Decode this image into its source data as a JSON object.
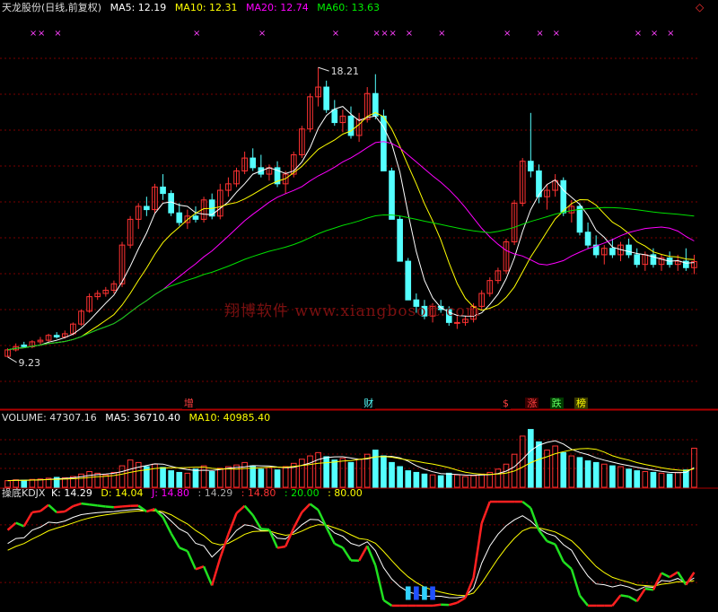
{
  "colors": {
    "up": "#ff3232",
    "down": "#54ffff",
    "ma5": "#ffffff",
    "ma10": "#ffff00",
    "ma20": "#ff00ff",
    "ma60": "#00e000",
    "grid": "#7a0000",
    "k": "#ffffff",
    "d": "#ffff00",
    "j": "#ff00ff"
  },
  "price_header": {
    "title": "天龙股份(日线,前复权)",
    "ma5": "MA5: 12.19",
    "ma10": "MA10: 12.31",
    "ma20": "MA20: 12.74",
    "ma60": "MA60: 13.63"
  },
  "volume_header": {
    "title": "VOLUME: 47307.16",
    "ma5": "MA5: 36710.40",
    "ma10": "MA10: 40985.40"
  },
  "kdj_header": {
    "title": "操底KDJX",
    "k": "K: 14.29",
    "d": "D: 14.04",
    "j": "J: 14.80",
    "v1": ": 14.29",
    "v2": ": 14.80",
    "v3": ": 20.00",
    "v4": ": 80.00"
  },
  "corner_icon": "diamond-icon",
  "watermark": "翔博软件 www.xiangbosoft.com",
  "flags": [
    {
      "text": "增",
      "color": "#ff4040",
      "bg": "#000000"
    },
    {
      "text": "财",
      "color": "#54ffff",
      "bg": "#000000"
    },
    {
      "text": "$",
      "color": "#ff4040",
      "bg": "#000000"
    },
    {
      "text": "涨",
      "color": "#ff4040",
      "bg": "#3a0000"
    },
    {
      "text": "跌",
      "color": "#60ff60",
      "bg": "#003a00"
    },
    {
      "text": "榜",
      "color": "#ffff00",
      "bg": "#3a3a00"
    }
  ],
  "chart_data": [
    {
      "type": "candlestick",
      "panel": "price",
      "ylim": [
        8.0,
        19.8
      ],
      "price_high_label": "18.21",
      "price_low_label": "9.23",
      "ohlc": [
        [
          9.25,
          9.5,
          9.23,
          9.45
        ],
        [
          9.45,
          9.65,
          9.4,
          9.55
        ],
        [
          9.6,
          9.7,
          9.5,
          9.55
        ],
        [
          9.55,
          9.75,
          9.5,
          9.7
        ],
        [
          9.7,
          9.85,
          9.6,
          9.75
        ],
        [
          9.75,
          9.95,
          9.7,
          9.9
        ],
        [
          9.9,
          10.0,
          9.8,
          9.85
        ],
        [
          9.85,
          10.05,
          9.8,
          9.95
        ],
        [
          9.95,
          10.3,
          9.9,
          10.25
        ],
        [
          10.25,
          10.7,
          10.2,
          10.65
        ],
        [
          10.65,
          11.2,
          10.6,
          11.1
        ],
        [
          11.1,
          11.3,
          11.0,
          11.2
        ],
        [
          11.2,
          11.4,
          11.1,
          11.3
        ],
        [
          11.3,
          11.6,
          11.2,
          11.5
        ],
        [
          11.5,
          12.8,
          11.4,
          12.7
        ],
        [
          12.7,
          13.6,
          12.6,
          13.5
        ],
        [
          13.5,
          14.0,
          13.2,
          13.9
        ],
        [
          13.9,
          14.2,
          13.6,
          13.8
        ],
        [
          13.8,
          14.6,
          13.7,
          14.5
        ],
        [
          14.5,
          14.9,
          14.1,
          14.3
        ],
        [
          14.3,
          14.4,
          13.6,
          13.7
        ],
        [
          13.7,
          14.0,
          13.3,
          13.4
        ],
        [
          13.4,
          13.8,
          13.2,
          13.6
        ],
        [
          13.6,
          13.9,
          13.4,
          13.5
        ],
        [
          13.5,
          14.2,
          13.4,
          14.1
        ],
        [
          14.1,
          14.3,
          13.5,
          13.6
        ],
        [
          13.6,
          14.6,
          13.5,
          14.4
        ],
        [
          14.4,
          14.8,
          14.2,
          14.6
        ],
        [
          14.6,
          15.1,
          14.5,
          15.0
        ],
        [
          15.0,
          15.6,
          14.9,
          15.4
        ],
        [
          15.4,
          15.7,
          15.0,
          15.1
        ],
        [
          15.1,
          15.5,
          14.8,
          14.9
        ],
        [
          14.9,
          15.2,
          14.7,
          15.1
        ],
        [
          15.1,
          15.3,
          14.5,
          14.6
        ],
        [
          14.6,
          15.0,
          14.3,
          14.9
        ],
        [
          14.9,
          15.6,
          14.8,
          15.5
        ],
        [
          15.5,
          16.4,
          15.4,
          16.3
        ],
        [
          16.3,
          17.4,
          16.2,
          17.3
        ],
        [
          17.3,
          18.21,
          17.0,
          17.6
        ],
        [
          17.6,
          17.8,
          16.8,
          16.9
        ],
        [
          16.9,
          17.2,
          16.4,
          16.5
        ],
        [
          16.5,
          16.9,
          16.2,
          16.7
        ],
        [
          16.7,
          17.0,
          16.0,
          16.1
        ],
        [
          16.1,
          16.8,
          15.9,
          16.6
        ],
        [
          16.6,
          17.6,
          16.5,
          17.4
        ],
        [
          17.4,
          18.0,
          16.6,
          16.7
        ],
        [
          16.7,
          16.9,
          15.0,
          15.0
        ],
        [
          15.0,
          15.1,
          13.5,
          13.5
        ],
        [
          13.5,
          13.6,
          12.2,
          12.2
        ],
        [
          12.2,
          12.3,
          11.0,
          11.0
        ],
        [
          11.0,
          11.2,
          10.6,
          10.8
        ],
        [
          10.8,
          11.0,
          10.4,
          10.5
        ],
        [
          10.5,
          10.9,
          10.3,
          10.8
        ],
        [
          10.8,
          11.0,
          10.6,
          10.7
        ],
        [
          10.7,
          10.8,
          10.2,
          10.3
        ],
        [
          10.3,
          10.5,
          10.1,
          10.3
        ],
        [
          10.3,
          10.5,
          10.2,
          10.4
        ],
        [
          10.4,
          10.9,
          10.3,
          10.8
        ],
        [
          10.8,
          11.3,
          10.7,
          11.2
        ],
        [
          11.2,
          11.7,
          11.1,
          11.6
        ],
        [
          11.6,
          12.0,
          11.5,
          11.9
        ],
        [
          11.9,
          12.9,
          11.8,
          12.8
        ],
        [
          12.8,
          14.1,
          12.7,
          14.0
        ],
        [
          14.0,
          15.4,
          13.9,
          15.3
        ],
        [
          15.3,
          16.8,
          14.8,
          15.0
        ],
        [
          15.0,
          15.2,
          14.0,
          14.2
        ],
        [
          14.2,
          14.6,
          13.8,
          14.4
        ],
        [
          14.4,
          14.9,
          14.2,
          14.7
        ],
        [
          14.7,
          14.8,
          13.6,
          13.7
        ],
        [
          13.7,
          14.1,
          13.4,
          13.9
        ],
        [
          13.9,
          14.0,
          13.0,
          13.1
        ],
        [
          13.1,
          13.4,
          12.6,
          12.7
        ],
        [
          12.7,
          13.0,
          12.3,
          12.4
        ],
        [
          12.4,
          12.7,
          12.1,
          12.6
        ],
        [
          12.6,
          12.9,
          12.3,
          12.4
        ],
        [
          12.4,
          12.8,
          12.2,
          12.7
        ],
        [
          12.7,
          12.9,
          12.3,
          12.4
        ],
        [
          12.4,
          12.6,
          12.0,
          12.1
        ],
        [
          12.1,
          12.5,
          11.9,
          12.4
        ],
        [
          12.4,
          12.6,
          12.0,
          12.1
        ],
        [
          12.1,
          12.4,
          11.9,
          12.3
        ],
        [
          12.3,
          12.5,
          12.0,
          12.1
        ],
        [
          12.1,
          12.4,
          11.9,
          12.2
        ],
        [
          12.2,
          12.6,
          11.9,
          12.0
        ],
        [
          12.0,
          12.4,
          11.8,
          12.19
        ]
      ],
      "series_colors": [
        "ma5",
        "ma10",
        "ma20",
        "ma60"
      ],
      "signals": [
        3,
        4,
        6,
        23,
        31,
        40,
        45,
        46,
        47,
        49,
        53,
        61,
        65,
        67,
        77,
        79,
        81
      ]
    },
    {
      "type": "bar",
      "panel": "volume",
      "ylim": [
        0,
        75000
      ],
      "values": [
        8000,
        9000,
        8500,
        9500,
        10000,
        11000,
        12000,
        11500,
        13000,
        16000,
        19000,
        17000,
        15000,
        18000,
        26000,
        33000,
        30000,
        25000,
        28000,
        24000,
        20000,
        18000,
        17000,
        22000,
        26000,
        19000,
        23000,
        25000,
        27000,
        30000,
        26000,
        22000,
        24000,
        21000,
        25000,
        29000,
        34000,
        38000,
        42000,
        37000,
        33000,
        35000,
        30000,
        34000,
        40000,
        45000,
        38000,
        30000,
        25000,
        20000,
        18000,
        16000,
        15000,
        14000,
        17000,
        15000,
        13000,
        14000,
        16000,
        18000,
        22000,
        28000,
        40000,
        62000,
        70000,
        55000,
        45000,
        50000,
        42000,
        38000,
        36000,
        32000,
        30000,
        28000,
        26000,
        25000,
        22000,
        20000,
        19000,
        18000,
        17000,
        16000,
        18000,
        21000,
        47307.16
      ],
      "ma5_color": "ma5",
      "ma10_color": "ma10"
    },
    {
      "type": "line",
      "panel": "kdj",
      "ylim": [
        -5,
        105
      ],
      "reference_levels": [
        20,
        80
      ],
      "k_color": "k",
      "d_color": "d",
      "j_color": "j"
    }
  ]
}
